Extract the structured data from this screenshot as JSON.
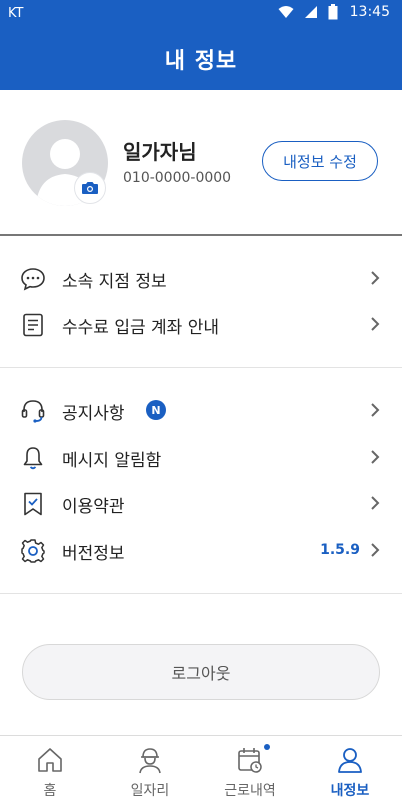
{
  "status_bar": {
    "carrier": "KT",
    "time": "13:45"
  },
  "app_bar": {
    "title": "내 정보"
  },
  "profile": {
    "name": "일가자님",
    "phone": "010-0000-0000",
    "edit_label": "내정보 수정"
  },
  "menu_group1": [
    {
      "label": "소속 지점 정보",
      "icon": "chat-bubble-icon"
    },
    {
      "label": "수수료 입금 계좌 안내",
      "icon": "document-icon"
    }
  ],
  "menu_group2": [
    {
      "label": "공지사항",
      "icon": "headset-icon",
      "badge": "N"
    },
    {
      "label": "메시지 알림함",
      "icon": "bell-icon"
    },
    {
      "label": "이용약관",
      "icon": "bookmark-check-icon"
    },
    {
      "label": "버전정보",
      "icon": "gear-icon",
      "value": "1.5.9"
    }
  ],
  "logout_label": "로그아웃",
  "tabs": [
    {
      "label": "홈",
      "icon": "home-icon"
    },
    {
      "label": "일자리",
      "icon": "worker-icon"
    },
    {
      "label": "근로내역",
      "icon": "calendar-icon"
    },
    {
      "label": "내정보",
      "icon": "person-icon",
      "active": true
    }
  ],
  "colors": {
    "primary": "#1a5fc2",
    "text": "#222222",
    "muted": "#666666"
  }
}
